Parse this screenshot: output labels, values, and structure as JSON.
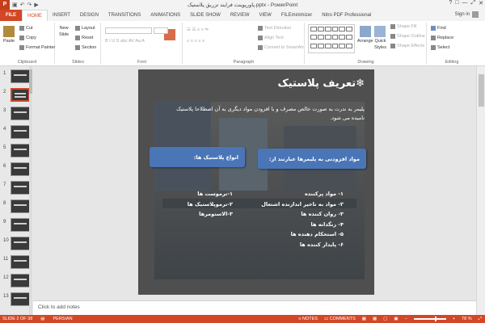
{
  "app": {
    "title": "پاورپوینت فرایند تزریق پلاستیک.pptx - PowerPoint",
    "icon": "P",
    "qat": [
      "save-icon",
      "undo-icon",
      "redo-icon",
      "start-presentation-icon"
    ],
    "win_btns": [
      "?",
      "□",
      "—",
      "⤢",
      "✕"
    ],
    "signin": "Sign in"
  },
  "tabs": [
    {
      "label": "FILE"
    },
    {
      "label": "HOME"
    },
    {
      "label": "INSERT"
    },
    {
      "label": "DESIGN"
    },
    {
      "label": "TRANSITIONS"
    },
    {
      "label": "ANIMATIONS"
    },
    {
      "label": "SLIDE SHOW"
    },
    {
      "label": "REVIEW"
    },
    {
      "label": "VIEW"
    },
    {
      "label": "FILEminimizer"
    },
    {
      "label": "Nitro PDF Professional"
    }
  ],
  "ribbon": {
    "clipboard": {
      "label": "Clipboard",
      "paste": "Paste",
      "cut": "Cut",
      "copy": "Copy",
      "format_painter": "Format Painter"
    },
    "slides": {
      "label": "Slides",
      "new_slide": "New",
      "new_slide2": "Slide",
      "layout": "Layout",
      "reset": "Reset",
      "section": "Section"
    },
    "font": {
      "label": "Font"
    },
    "paragraph": {
      "label": "Paragraph",
      "text_direction": "Text Direction",
      "align_text": "Align Text",
      "convert": "Convert to SmartArt"
    },
    "drawing": {
      "label": "Drawing",
      "arrange": "Arrange",
      "quick_styles": "Quick",
      "quick_styles2": "Styles",
      "shape_fill": "Shape Fill",
      "shape_outline": "Shape Outline",
      "shape_effects": "Shape Effects"
    },
    "editing": {
      "label": "Editing",
      "find": "Find",
      "replace": "Replace",
      "select": "Select"
    }
  },
  "thumbnails": [
    "1",
    "2",
    "3",
    "4",
    "5",
    "6",
    "7",
    "8",
    "9",
    "10",
    "11",
    "12",
    "13"
  ],
  "slide": {
    "title": "❄تعریف پلاستیک",
    "paragraph": "پلیمر به ندرت به صورت خالص مصرف و با افزودن مواد دیگری به آن اصطلاحا پلاستیک نامیده می شود.",
    "box_right": "مواد افزودنی به پلیمرها عبارتند از:",
    "box_left": "انواع پلاستیک ها:",
    "list_right": [
      "۱- مواد پرکننده",
      "۲- مواد به تاخیر اندازنده اشتعال",
      "۳- روان کننده ها",
      "۴- رنگدانه ها",
      "۵- استحکام دهنده ها",
      "۶- پایدار کننده ها"
    ],
    "list_left": [
      "۱-ترموست ها",
      "۲-ترموپلاستیک ها",
      "۳-الاستومرها"
    ]
  },
  "notes_placeholder": "Click to add notes",
  "status": {
    "slide": "SLIDE 2 OF 38",
    "language": "PERSIAN",
    "notes": "NOTES",
    "comments": "COMMENTS",
    "zoom": "78 %"
  }
}
